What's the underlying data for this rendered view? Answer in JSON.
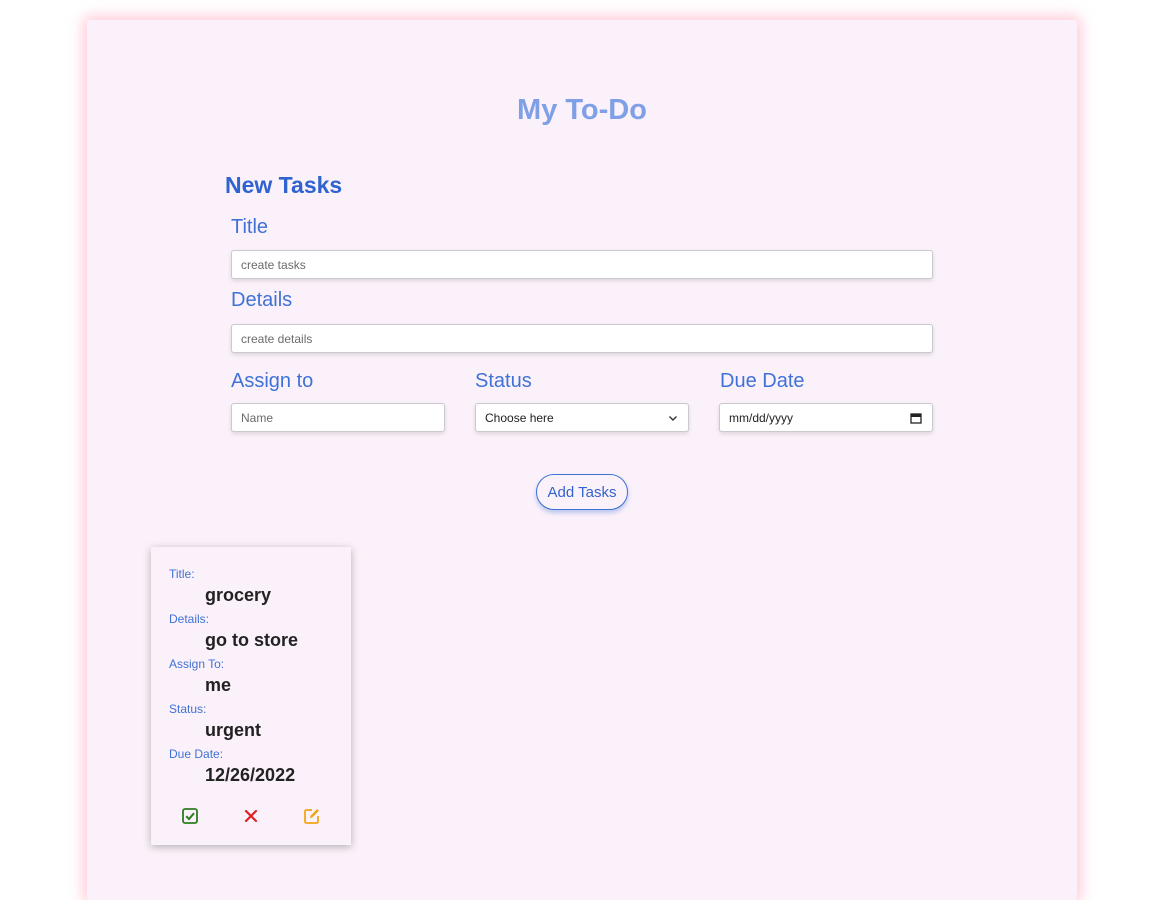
{
  "app": {
    "title": "My To-Do"
  },
  "form": {
    "section_title": "New Tasks",
    "title_label": "Title",
    "title_placeholder": "create tasks",
    "details_label": "Details",
    "details_placeholder": "create details",
    "assign_label": "Assign to",
    "assign_placeholder": "Name",
    "status_label": "Status",
    "status_selected": "Choose here",
    "due_label": "Due Date",
    "due_placeholder": "mm/dd/yyyy",
    "add_button": "Add Tasks"
  },
  "task_card": {
    "title_label": "Title:",
    "title_value": "grocery",
    "details_label": "Details:",
    "details_value": "go to store",
    "assign_label": "Assign To:",
    "assign_value": "me",
    "status_label": "Status:",
    "status_value": "urgent",
    "due_label": "Due Date:",
    "due_value": "12/26/2022",
    "actions": {
      "complete_icon": "check-square-icon",
      "delete_icon": "x-icon",
      "edit_icon": "edit-icon"
    }
  },
  "colors": {
    "panel_bg": "#fbf1fa",
    "heading": "#7fa0e6",
    "accent_blue": "#2f63cf",
    "complete_green": "#2e7d1f",
    "delete_red": "#e02020",
    "edit_orange": "#f2a516"
  }
}
